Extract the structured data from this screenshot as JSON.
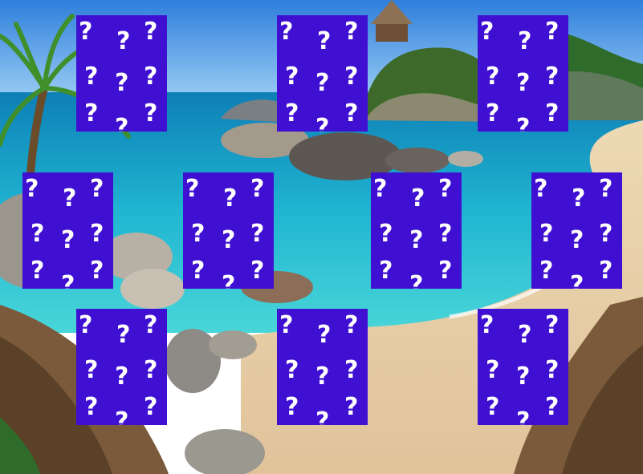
{
  "game": {
    "card_back_symbol": "?",
    "card_back_color": "#3f0fd2",
    "card_face_state": "face-down",
    "background": "tropical beach with turquoise water, rocks and palm tree"
  },
  "cards": [
    {
      "id": "card-1"
    },
    {
      "id": "card-2"
    },
    {
      "id": "card-3"
    },
    {
      "id": "card-4"
    },
    {
      "id": "card-5"
    },
    {
      "id": "card-6"
    },
    {
      "id": "card-7"
    },
    {
      "id": "card-8"
    },
    {
      "id": "card-9"
    },
    {
      "id": "card-10"
    }
  ]
}
